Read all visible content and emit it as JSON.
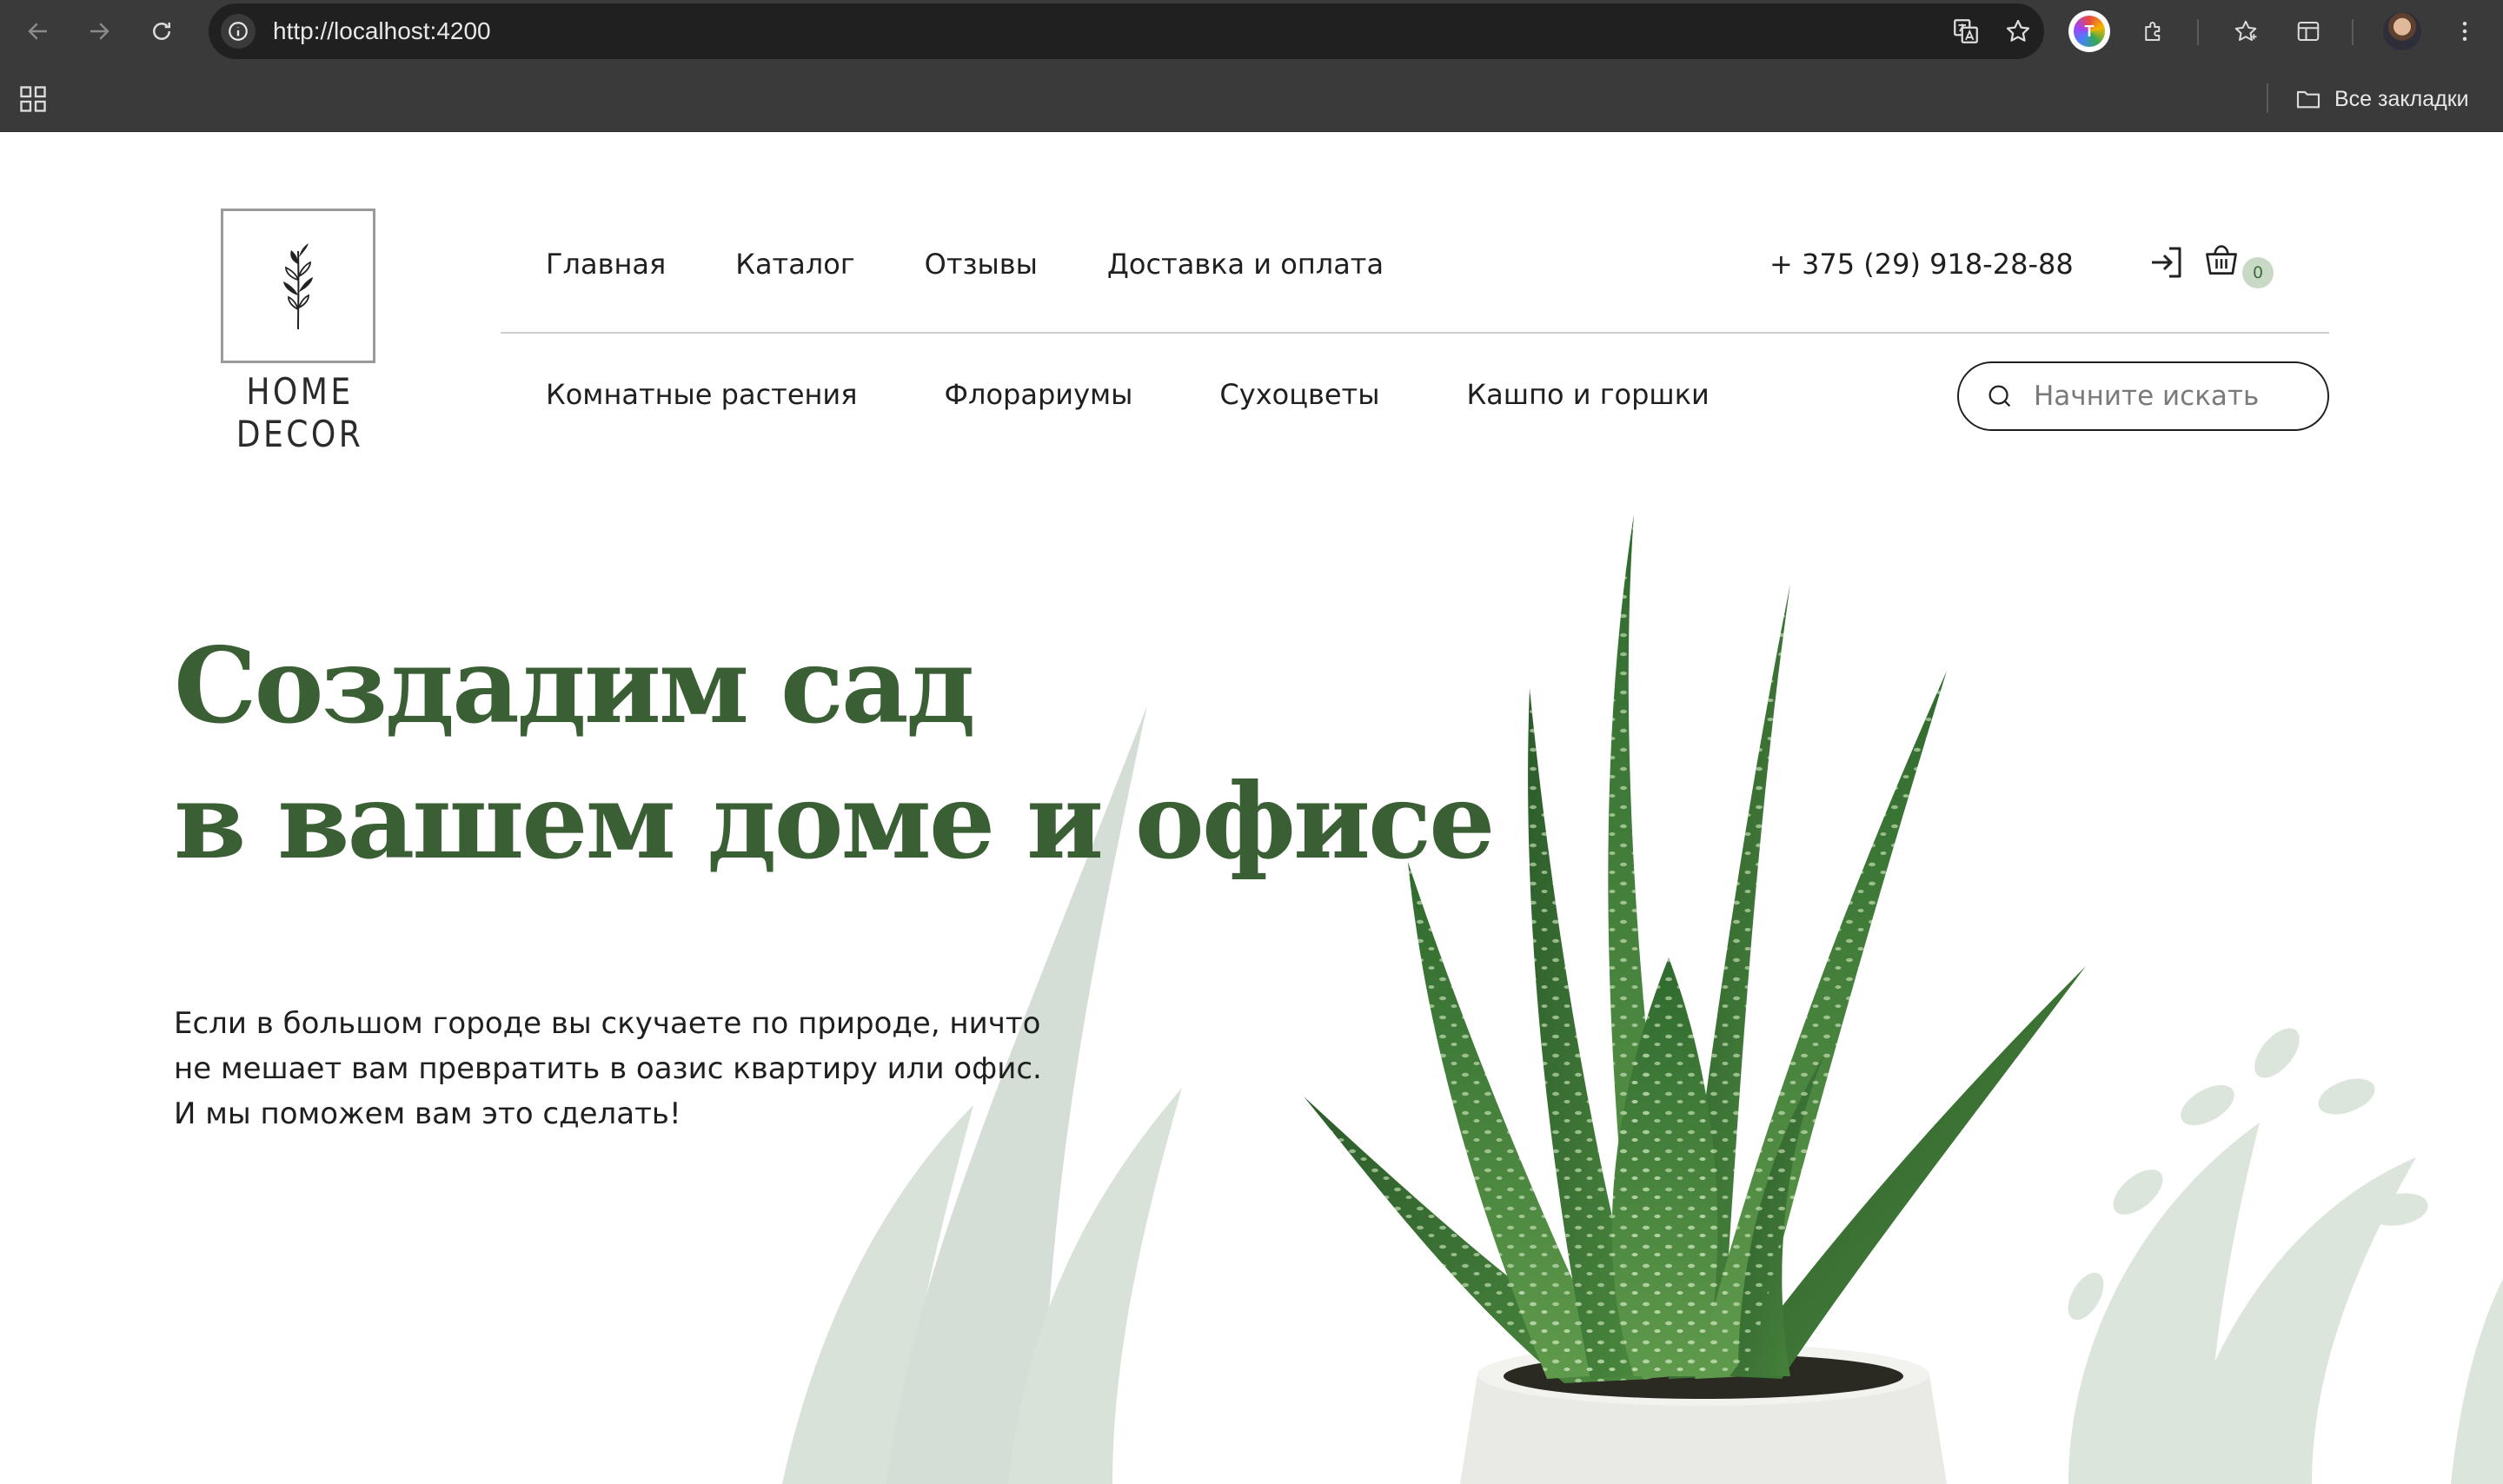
{
  "browser": {
    "url": "http://localhost:4200",
    "bookmarks_label": "Все закладки",
    "extension_letter": "T"
  },
  "site": {
    "logo_text": "HOME DECOR",
    "nav": [
      "Главная",
      "Каталог",
      "Отзывы",
      "Доставка и оплата"
    ],
    "phone": "+ 375 (29) 918-28-88",
    "cart_count": "0",
    "categories": [
      "Комнатные растения",
      "Флорариумы",
      "Сухоцветы",
      "Кашпо и горшки"
    ],
    "search_placeholder": "Начните искать"
  },
  "hero": {
    "title_line1": "Создадим сад",
    "title_line2": "в вашем доме и офисе",
    "text_line1": "Если в большом городе вы скучаете по природе, ничто",
    "text_line2": "не мешает вам превратить в оазис квартиру или офис.",
    "text_line3": "И мы поможем вам это сделать!"
  },
  "colors": {
    "accent_green": "#3b5f34",
    "badge_bg": "#c8d9c5",
    "chrome_bg": "#3a3a3a"
  }
}
